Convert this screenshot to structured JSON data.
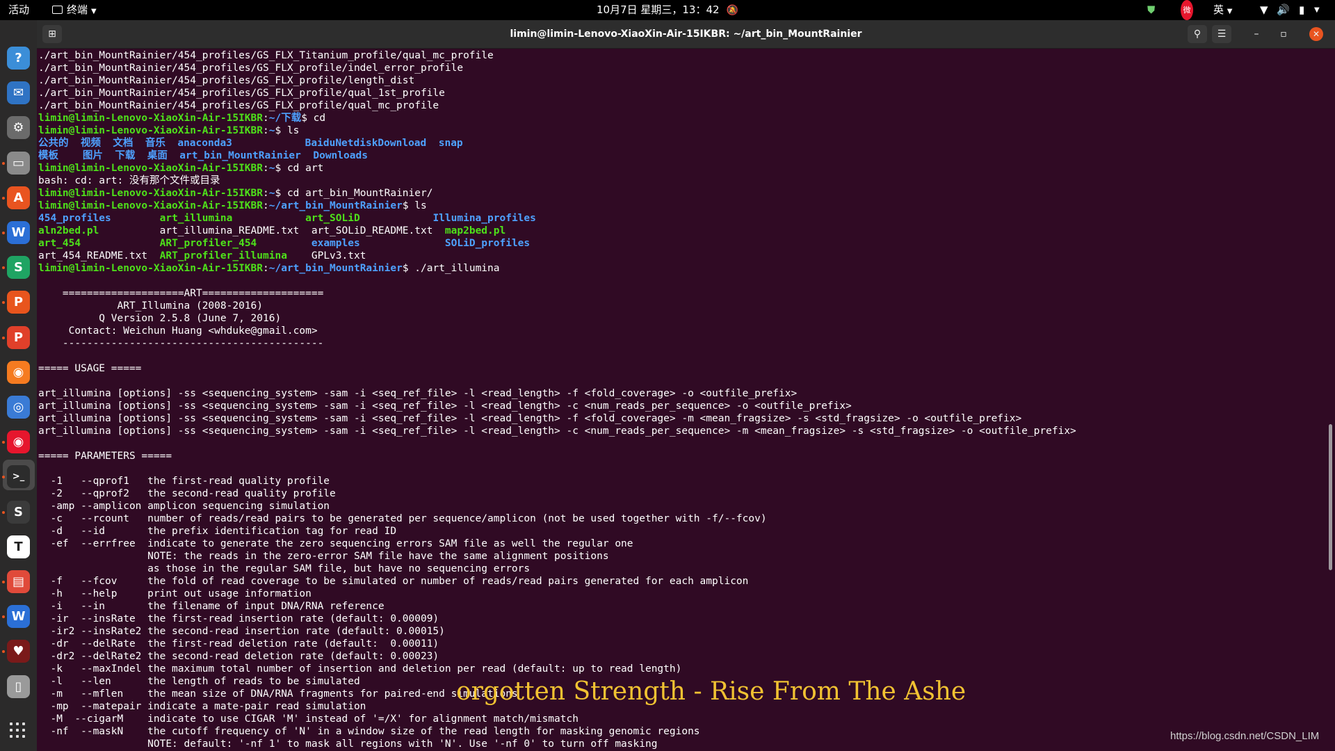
{
  "topbar": {
    "activities": "活动",
    "app_menu": "终端",
    "clock": "10月7日 星期三，13：42",
    "ime": "英",
    "tray_icons": [
      "shield-icon",
      "weibo-icon",
      "wifi-icon",
      "volume-icon",
      "battery-icon"
    ]
  },
  "dock": {
    "apps": [
      {
        "name": "help",
        "color": "#3b8ed8",
        "glyph": "?"
      },
      {
        "name": "thunderbird",
        "color": "#2f73c4",
        "glyph": "✉"
      },
      {
        "name": "settings",
        "color": "#6b6b6b",
        "glyph": "⚙"
      },
      {
        "name": "files",
        "color": "#8a8a8a",
        "glyph": "▭"
      },
      {
        "name": "software",
        "color": "#e95420",
        "glyph": "A"
      },
      {
        "name": "wps-writer",
        "color": "#2b6fd6",
        "glyph": "W"
      },
      {
        "name": "wps-spreadsheets",
        "color": "#1fa463",
        "glyph": "S"
      },
      {
        "name": "wps-presentation",
        "color": "#e8551d",
        "glyph": "P"
      },
      {
        "name": "wps-pdf",
        "color": "#e0402a",
        "glyph": "P"
      },
      {
        "name": "firefox",
        "color": "#f57b20",
        "glyph": "◉"
      },
      {
        "name": "chrome",
        "color": "#3a7bd5",
        "glyph": "◎"
      },
      {
        "name": "weibo",
        "color": "#e6162d",
        "glyph": "◉"
      },
      {
        "name": "terminal",
        "color": "#2c2c2c",
        "glyph": ">_"
      },
      {
        "name": "sublime-text",
        "color": "#3b3b3b",
        "glyph": "S"
      },
      {
        "name": "typora",
        "color": "#ffffff",
        "glyph": "T"
      },
      {
        "name": "screenshot-tool",
        "color": "#e04a3a",
        "glyph": "▤"
      },
      {
        "name": "wps-office",
        "color": "#2b6fd6",
        "glyph": "W"
      },
      {
        "name": "wine",
        "color": "#7a1a1a",
        "glyph": "♥"
      },
      {
        "name": "ssd-drive",
        "color": "#9a9a9a",
        "glyph": "▯"
      }
    ]
  },
  "window": {
    "title": "limin@limin-Lenovo-XiaoXin-Air-15IKBR: ~/art_bin_MountRainier"
  },
  "terminal": {
    "lines": [
      [
        [
          "w",
          "./art_bin_MountRainier/454_profiles/GS_FLX_Titanium_profile/qual_mc_profile"
        ]
      ],
      [
        [
          "w",
          "./art_bin_MountRainier/454_profiles/GS_FLX_profile/indel_error_profile"
        ]
      ],
      [
        [
          "w",
          "./art_bin_MountRainier/454_profiles/GS_FLX_profile/length_dist"
        ]
      ],
      [
        [
          "w",
          "./art_bin_MountRainier/454_profiles/GS_FLX_profile/qual_1st_profile"
        ]
      ],
      [
        [
          "w",
          "./art_bin_MountRainier/454_profiles/GS_FLX_profile/qual_mc_profile"
        ]
      ],
      [
        [
          "g",
          "limin@limin-Lenovo-XiaoXin-Air-15IKBR"
        ],
        [
          "w",
          ":"
        ],
        [
          "b",
          "~/下载"
        ],
        [
          "w",
          "$ cd"
        ]
      ],
      [
        [
          "g",
          "limin@limin-Lenovo-XiaoXin-Air-15IKBR"
        ],
        [
          "w",
          ":"
        ],
        [
          "b",
          "~"
        ],
        [
          "w",
          "$ ls"
        ]
      ],
      [
        [
          "b",
          "公共的  视频  文档  音乐  "
        ],
        [
          "b",
          "anaconda3            "
        ],
        [
          "b",
          "BaiduNetdiskDownload  "
        ],
        [
          "b",
          "snap"
        ]
      ],
      [
        [
          "b",
          "模板    图片  下载  桌面  "
        ],
        [
          "b",
          "art_bin_MountRainier  "
        ],
        [
          "b",
          "Downloads"
        ]
      ],
      [
        [
          "g",
          "limin@limin-Lenovo-XiaoXin-Air-15IKBR"
        ],
        [
          "w",
          ":"
        ],
        [
          "b",
          "~"
        ],
        [
          "w",
          "$ cd art"
        ]
      ],
      [
        [
          "w",
          "bash: cd: art: 没有那个文件或目录"
        ]
      ],
      [
        [
          "g",
          "limin@limin-Lenovo-XiaoXin-Air-15IKBR"
        ],
        [
          "w",
          ":"
        ],
        [
          "b",
          "~"
        ],
        [
          "w",
          "$ cd art_bin_MountRainier/"
        ]
      ],
      [
        [
          "g",
          "limin@limin-Lenovo-XiaoXin-Air-15IKBR"
        ],
        [
          "w",
          ":"
        ],
        [
          "b",
          "~/art_bin_MountRainier"
        ],
        [
          "w",
          "$ ls"
        ]
      ],
      [
        [
          "b",
          "454_profiles        "
        ],
        [
          "gr",
          "art_illumina            "
        ],
        [
          "gr",
          "art_SOLiD            "
        ],
        [
          "b",
          "Illumina_profiles"
        ]
      ],
      [
        [
          "gr",
          "aln2bed.pl          "
        ],
        [
          "w",
          "art_illumina_README.txt  "
        ],
        [
          "w",
          "art_SOLiD_README.txt  "
        ],
        [
          "gr",
          "map2bed.pl"
        ]
      ],
      [
        [
          "gr",
          "art_454             "
        ],
        [
          "gr",
          "ART_profiler_454         "
        ],
        [
          "b",
          "examples              "
        ],
        [
          "b",
          "SOLiD_profiles"
        ]
      ],
      [
        [
          "w",
          "art_454_README.txt  "
        ],
        [
          "gr",
          "ART_profiler_illumina    "
        ],
        [
          "w",
          "GPLv3.txt"
        ]
      ],
      [
        [
          "g",
          "limin@limin-Lenovo-XiaoXin-Air-15IKBR"
        ],
        [
          "w",
          ":"
        ],
        [
          "b",
          "~/art_bin_MountRainier"
        ],
        [
          "w",
          "$ ./art_illumina"
        ]
      ],
      [
        [
          "w",
          ""
        ]
      ],
      [
        [
          "w",
          "    ====================ART===================="
        ]
      ],
      [
        [
          "w",
          "             ART_Illumina (2008-2016)"
        ]
      ],
      [
        [
          "w",
          "          Q Version 2.5.8 (June 7, 2016)"
        ]
      ],
      [
        [
          "w",
          "     Contact: Weichun Huang <whduke@gmail.com>"
        ]
      ],
      [
        [
          "w",
          "    -------------------------------------------"
        ]
      ],
      [
        [
          "w",
          ""
        ]
      ],
      [
        [
          "w",
          "===== USAGE ====="
        ]
      ],
      [
        [
          "w",
          ""
        ]
      ],
      [
        [
          "w",
          "art_illumina [options] -ss <sequencing_system> -sam -i <seq_ref_file> -l <read_length> -f <fold_coverage> -o <outfile_prefix>"
        ]
      ],
      [
        [
          "w",
          "art_illumina [options] -ss <sequencing_system> -sam -i <seq_ref_file> -l <read_length> -c <num_reads_per_sequence> -o <outfile_prefix>"
        ]
      ],
      [
        [
          "w",
          "art_illumina [options] -ss <sequencing_system> -sam -i <seq_ref_file> -l <read_length> -f <fold_coverage> -m <mean_fragsize> -s <std_fragsize> -o <outfile_prefix>"
        ]
      ],
      [
        [
          "w",
          "art_illumina [options] -ss <sequencing_system> -sam -i <seq_ref_file> -l <read_length> -c <num_reads_per_sequence> -m <mean_fragsize> -s <std_fragsize> -o <outfile_prefix>"
        ]
      ],
      [
        [
          "w",
          ""
        ]
      ],
      [
        [
          "w",
          "===== PARAMETERS ====="
        ]
      ],
      [
        [
          "w",
          ""
        ]
      ],
      [
        [
          "w",
          "  -1   --qprof1   the first-read quality profile"
        ]
      ],
      [
        [
          "w",
          "  -2   --qprof2   the second-read quality profile"
        ]
      ],
      [
        [
          "w",
          "  -amp --amplicon amplicon sequencing simulation"
        ]
      ],
      [
        [
          "w",
          "  -c   --rcount   number of reads/read pairs to be generated per sequence/amplicon (not be used together with -f/--fcov)"
        ]
      ],
      [
        [
          "w",
          "  -d   --id       the prefix identification tag for read ID"
        ]
      ],
      [
        [
          "w",
          "  -ef  --errfree  indicate to generate the zero sequencing errors SAM file as well the regular one"
        ]
      ],
      [
        [
          "w",
          "                  NOTE: the reads in the zero-error SAM file have the same alignment positions"
        ]
      ],
      [
        [
          "w",
          "                  as those in the regular SAM file, but have no sequencing errors"
        ]
      ],
      [
        [
          "w",
          "  -f   --fcov     the fold of read coverage to be simulated or number of reads/read pairs generated for each amplicon"
        ]
      ],
      [
        [
          "w",
          "  -h   --help     print out usage information"
        ]
      ],
      [
        [
          "w",
          "  -i   --in       the filename of input DNA/RNA reference"
        ]
      ],
      [
        [
          "w",
          "  -ir  --insRate  the first-read insertion rate (default: 0.00009)"
        ]
      ],
      [
        [
          "w",
          "  -ir2 --insRate2 the second-read insertion rate (default: 0.00015)"
        ]
      ],
      [
        [
          "w",
          "  -dr  --delRate  the first-read deletion rate (default:  0.00011)"
        ]
      ],
      [
        [
          "w",
          "  -dr2 --delRate2 the second-read deletion rate (default: 0.00023)"
        ]
      ],
      [
        [
          "w",
          "  -k   --maxIndel the maximum total number of insertion and deletion per read (default: up to read length)"
        ]
      ],
      [
        [
          "w",
          "  -l   --len      the length of reads to be simulated"
        ]
      ],
      [
        [
          "w",
          "  -m   --mflen    the mean size of DNA/RNA fragments for paired-end simulations"
        ]
      ],
      [
        [
          "w",
          "  -mp  --matepair indicate a mate-pair read simulation"
        ]
      ],
      [
        [
          "w",
          "  -M  --cigarM    indicate to use CIGAR 'M' instead of '=/X' for alignment match/mismatch"
        ]
      ],
      [
        [
          "w",
          "  -nf  --maskN    the cutoff frequency of 'N' in a window size of the read length for masking genomic regions"
        ]
      ],
      [
        [
          "w",
          "                  NOTE: default: '-nf 1' to mask all regions with 'N'. Use '-nf 0' to turn off masking"
        ]
      ]
    ]
  },
  "overlay": {
    "lyric": "orgotten Strength - Rise From The Ashe",
    "watermark": "https://blog.csdn.net/CSDN_LIM"
  }
}
